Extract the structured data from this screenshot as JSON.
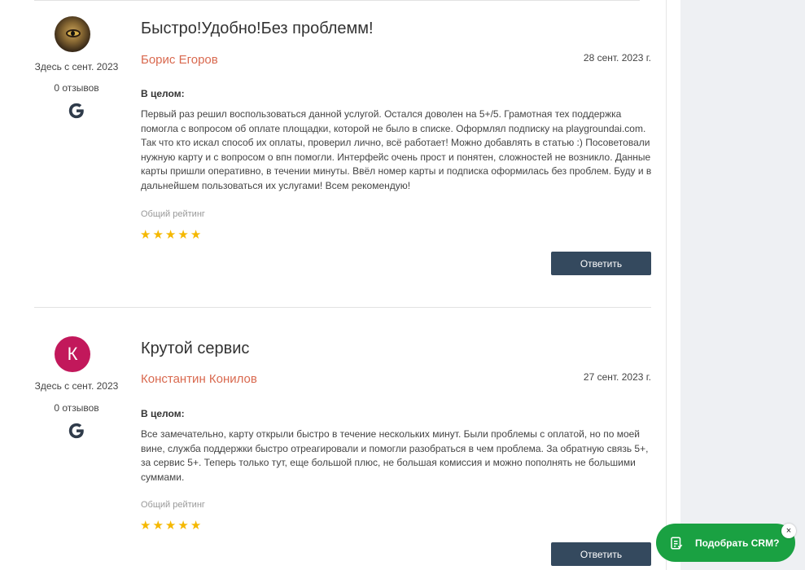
{
  "reviews": [
    {
      "title": "Быстро!Удобно!Без проблемм!",
      "author": "Борис Егоров",
      "date": "28 сент. 2023 г.",
      "avatar": {
        "type": "image",
        "icon": "tiger-eye-photo"
      },
      "since": "Здесь с сент. 2023",
      "reviews_count": "0 отзывов",
      "overall_label": "В целом:",
      "text": "Первый раз решил воспользоваться данной услугой. Остался доволен на 5+/5. Грамотная тех поддержка помогла с вопросом об оплате площадки, которой не было в списке. Оформлял подписку на playgroundai.com. Так что кто искал способ их оплаты, проверил лично, всё работает! Можно добавлять в статью :) Посоветовали нужную карту и с вопросом о впн помогли. Интерфейс очень прост и понятен, сложностей не возникло. Данные карты пришли оперативно, в течении минуты. Ввёл номер карты и подписка оформилась без проблем. Буду и в дальнейшем пользоваться их услугами! Всем рекомендую!",
      "rating_label": "Общий рейтинг",
      "rating": 5,
      "reply_label": "Ответить"
    },
    {
      "title": "Крутой сервис",
      "author": "Константин Конилов",
      "date": "27 сент. 2023 г.",
      "avatar": {
        "type": "letter",
        "letter": "К",
        "color": "#c2185b"
      },
      "since": "Здесь с сент. 2023",
      "reviews_count": "0 отзывов",
      "overall_label": "В целом:",
      "text": "Все замечательно, карту открыли быстро в течение нескольких минут. Были проблемы с оплатой, но по моей вине, служба поддержки быстро отреагировали и помогли разобраться в чем проблема. За обратную связь 5+, за сервис 5+. Теперь только тут, еще большой плюс, не большая комиссия и можно пополнять не большими суммами.",
      "rating_label": "Общий рейтинг",
      "rating": 5,
      "reply_label": "Ответить"
    }
  ],
  "crm_widget": {
    "label": "Подобрать CRM?",
    "close": "×",
    "color": "#1aa142"
  },
  "colors": {
    "author": "#d9694f",
    "star": "#f5b800",
    "button": "#34495e"
  }
}
